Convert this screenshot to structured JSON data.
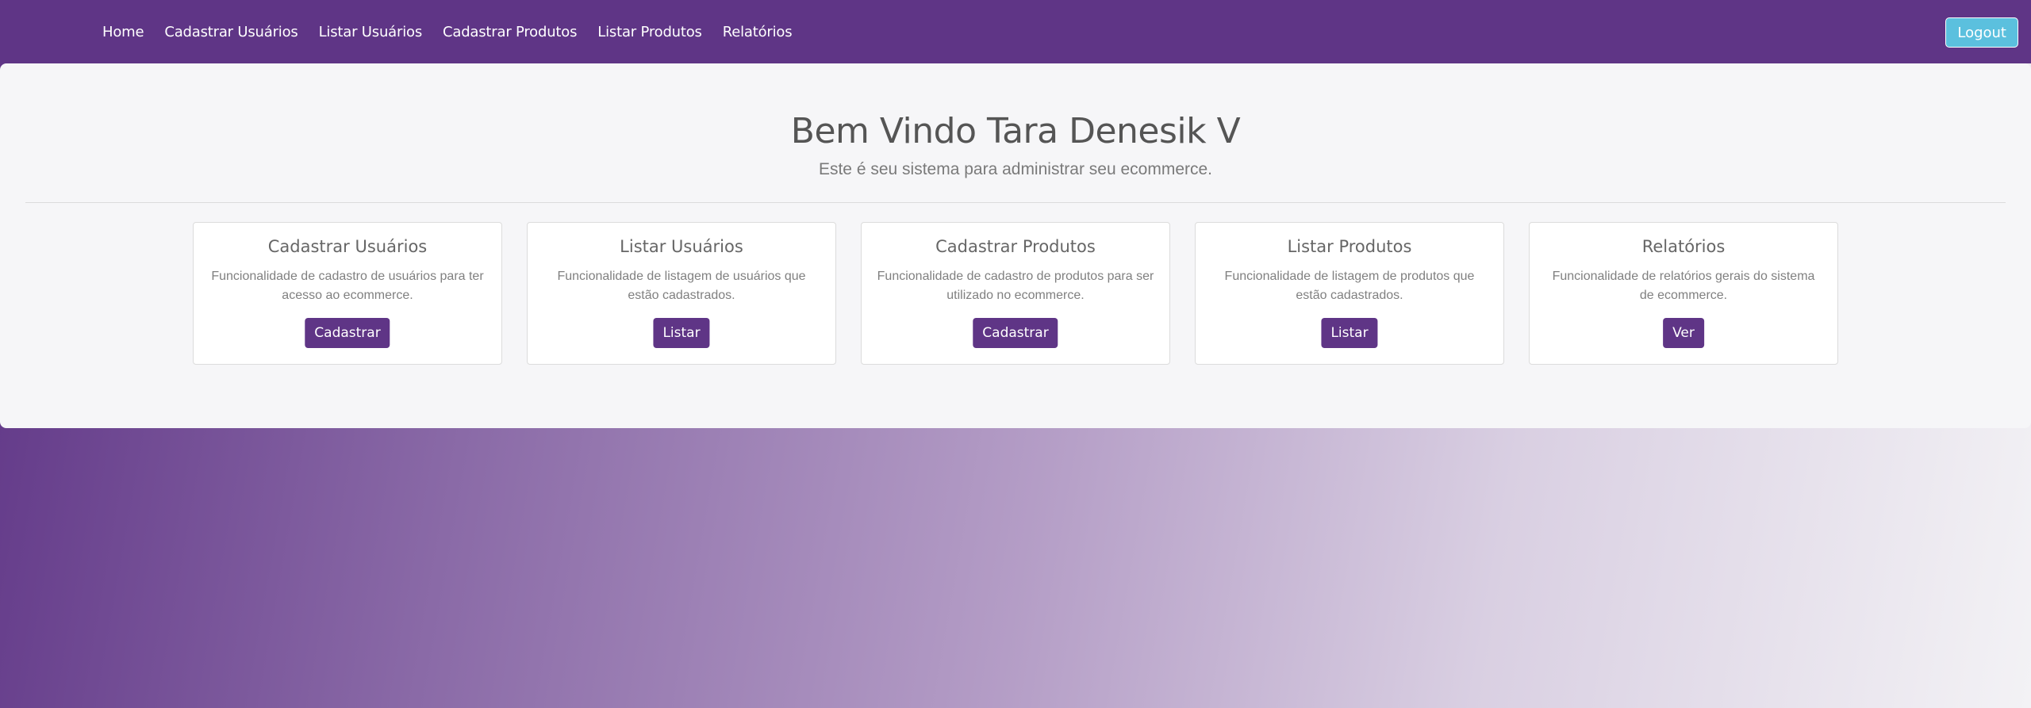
{
  "navbar": {
    "links": [
      {
        "label": "Home"
      },
      {
        "label": "Cadastrar Usuários"
      },
      {
        "label": "Listar Usuários"
      },
      {
        "label": "Cadastrar Produtos"
      },
      {
        "label": "Listar Produtos"
      },
      {
        "label": "Relatórios"
      }
    ],
    "logout_label": "Logout"
  },
  "welcome": {
    "title": "Bem Vindo Tara Denesik V",
    "subtitle": "Este é seu sistema para administrar seu ecommerce."
  },
  "cards": [
    {
      "title": "Cadastrar Usuários",
      "text": "Funcionalidade de cadastro de usuários para ter acesso ao ecommerce.",
      "button": "Cadastrar"
    },
    {
      "title": "Listar Usuários",
      "text": "Funcionalidade de listagem de usuários que estão cadastrados.",
      "button": "Listar"
    },
    {
      "title": "Cadastrar Produtos",
      "text": "Funcionalidade de cadastro de produtos para ser utilizado no ecommerce.",
      "button": "Cadastrar"
    },
    {
      "title": "Listar Produtos",
      "text": "Funcionalidade de listagem de produtos que estão cadastrados.",
      "button": "Listar"
    },
    {
      "title": "Relatórios",
      "text": "Funcionalidade de relatórios gerais do sistema de ecommerce.",
      "button": "Ver"
    }
  ],
  "colors": {
    "brand": "#5f3586",
    "logout": "#5bc0de",
    "panel": "#f6f6f8"
  }
}
